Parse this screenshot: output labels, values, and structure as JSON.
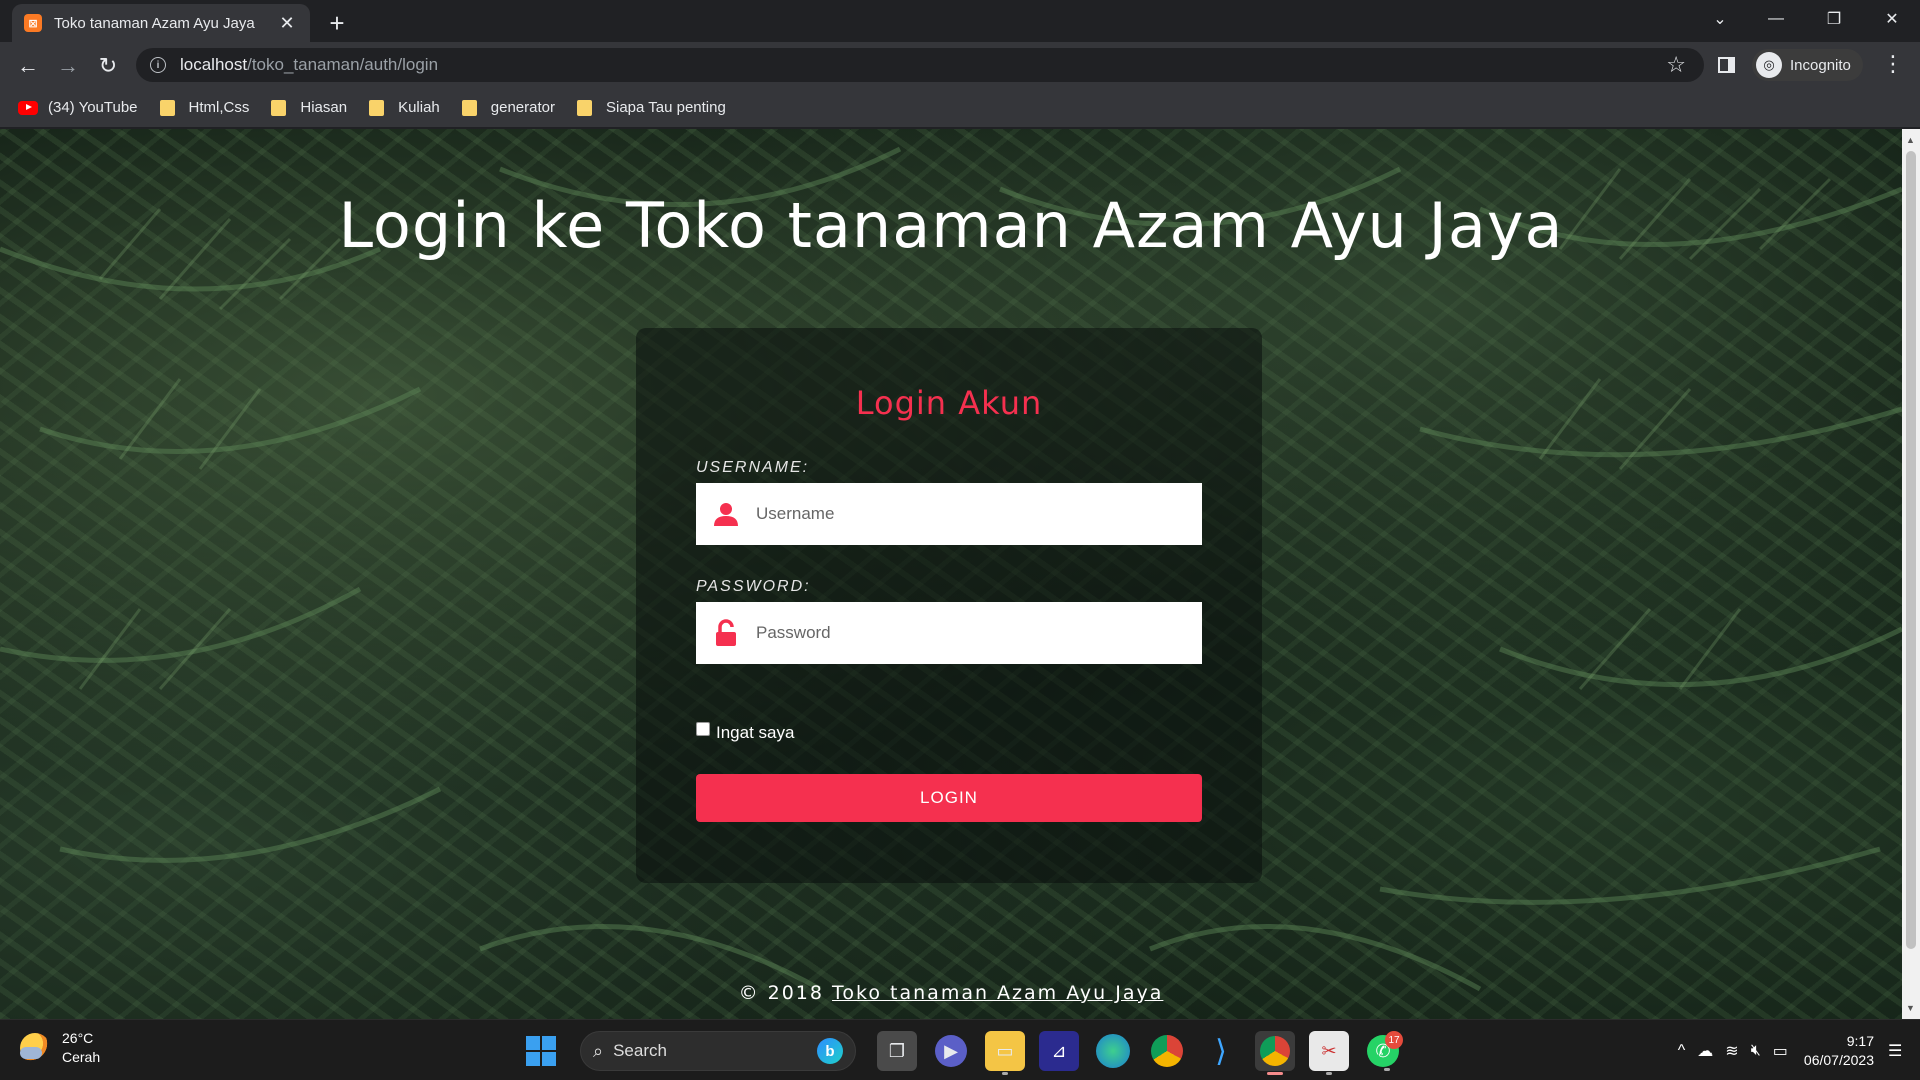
{
  "browser": {
    "tab_title": "Toko tanaman Azam Ayu Jaya",
    "url_host": "localhost",
    "url_path": "/toko_tanaman/auth/login",
    "profile_label": "Incognito"
  },
  "bookmarks": [
    {
      "label": "(34) YouTube",
      "icon": "youtube-icon"
    },
    {
      "label": "Html,Css",
      "icon": "folder-icon"
    },
    {
      "label": "Hiasan",
      "icon": "folder-icon"
    },
    {
      "label": "Kuliah",
      "icon": "folder-icon"
    },
    {
      "label": "generator",
      "icon": "folder-icon"
    },
    {
      "label": "Siapa Tau penting",
      "icon": "folder-icon"
    }
  ],
  "page": {
    "heading": "Login ke Toko tanaman Azam Ayu Jaya",
    "card_title": "Login Akun",
    "username_label": "USERNAME:",
    "username_placeholder": "Username",
    "password_label": "PASSWORD:",
    "password_placeholder": "Password",
    "remember_label": "Ingat saya",
    "login_button": "LOGIN",
    "footer_prefix": "© 2018",
    "footer_link": "Toko tanaman Azam Ayu Jaya",
    "accent_color": "#f5304f"
  },
  "taskbar": {
    "temperature": "26°C",
    "weather": "Cerah",
    "search_label": "Search",
    "whatsapp_badge": "17",
    "time": "9:17",
    "date": "06/07/2023"
  }
}
